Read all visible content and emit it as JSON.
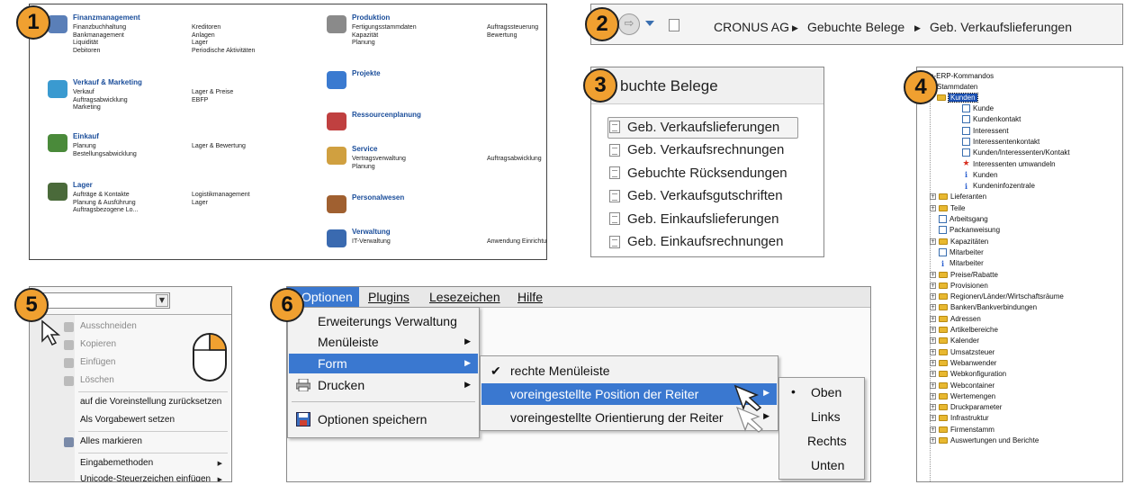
{
  "badges": [
    "1",
    "2",
    "3",
    "4",
    "5",
    "6"
  ],
  "panel1": {
    "groups": [
      {
        "title": "Finanzmanagement",
        "col1": [
          "Finanzbuchhaltung",
          "Bankmanagement",
          "Liquidität",
          "Debitoren"
        ],
        "col2": [
          "Kreditoren",
          "Anlagen",
          "Lager",
          "Periodische Aktivitäten"
        ],
        "icon": "finance-icon",
        "color": "#5a7fb8"
      },
      {
        "title": "Verkauf & Marketing",
        "col1": [
          "Verkauf",
          "Auftragsabwicklung",
          "Marketing"
        ],
        "col2": [
          "Lager & Preise",
          "EBFP"
        ],
        "icon": "globe-icon",
        "color": "#3a9ad0"
      },
      {
        "title": "Einkauf",
        "col1": [
          "Planung",
          "Bestellungsabwicklung"
        ],
        "col2": [
          "Lager & Bewertung"
        ],
        "icon": "purchase-icon",
        "color": "#4a8a3a"
      },
      {
        "title": "Lager",
        "col1": [
          "Aufträge & Kontakte",
          "Planung & Ausführung",
          "Auftragsbezogene Lo..."
        ],
        "col2": [
          "Logistikmanagement",
          "Lager"
        ],
        "icon": "warehouse-icon",
        "color": "#4a6a3a"
      },
      {
        "title": "Produktion",
        "col1": [
          "Fertigungsstammdaten",
          "Kapazität",
          "Planung"
        ],
        "col2": [
          "Auftragssteuerung",
          "Bewertung"
        ],
        "icon": "production-icon",
        "color": "#8a8a8a"
      },
      {
        "title": "Projekte",
        "col1": [],
        "col2": [],
        "icon": "projects-icon",
        "color": "#3a7ad0"
      },
      {
        "title": "Ressourcenplanung",
        "col1": [],
        "col2": [],
        "icon": "resource-planning-icon",
        "color": "#c04040"
      },
      {
        "title": "Service",
        "col1": [
          "Vertragsverwaltung",
          "Planung"
        ],
        "col2": [
          "Auftragsabwicklung"
        ],
        "icon": "service-icon",
        "color": "#d0a040"
      },
      {
        "title": "Personalwesen",
        "col1": [],
        "col2": [],
        "icon": "personnel-icon",
        "color": "#a06030"
      },
      {
        "title": "Verwaltung",
        "col1": [
          "IT-Verwaltung"
        ],
        "col2": [
          "Anwendung Einrichtung"
        ],
        "icon": "administration-icon",
        "color": "#3a6ab0"
      }
    ]
  },
  "panel2": {
    "crumbs": [
      "CRONUS AG",
      "Gebuchte Belege",
      "Geb. Verkaufslieferungen"
    ],
    "separator": "▶"
  },
  "panel3": {
    "header": "buchte Belege",
    "items": [
      "Geb. Verkaufslieferungen",
      "Geb. Verkaufsrechnungen",
      "Gebuchte Rücksendungen",
      "Geb. Verkaufsgutschriften",
      "Geb. Einkaufslieferungen",
      "Geb. Einkaufsrechnungen"
    ]
  },
  "panel4": {
    "root": "ves-ERP-Kommandos",
    "stammdaten": "Stammdaten",
    "kunden": "Kunden",
    "kunden_children": [
      "Kunde",
      "Kundenkontakt",
      "Interessent",
      "Interessentenkontakt",
      "Kunden/Interessenten/Kontakt",
      "Interessenten umwandeln",
      "Kunden",
      "Kundeninfozentrale"
    ],
    "rest": [
      "Lieferanten",
      "Teile",
      "Arbeitsgang",
      "Packanweisung",
      "Kapazitäten",
      "Mitarbeiter",
      "Mitarbeiter",
      "Preise/Rabatte",
      "Provisionen",
      "Regionen/Länder/Wirtschaftsräume",
      "Banken/Bankverbindungen",
      "Adressen",
      "Artikelbereiche",
      "Kalender",
      "Umsatzsteuer",
      "Webanwender",
      "Webkonfiguration",
      "Webcontainer",
      "Wertemengen",
      "Druckparameter",
      "Infrastruktur",
      "Firmenstamm",
      "Auswertungen und Berichte"
    ]
  },
  "panel5": {
    "items": [
      "Ausschneiden",
      "Kopieren",
      "Einfügen",
      "Löschen",
      "auf die Voreinstellung zurücksetzen",
      "Als Vorgabewert setzen",
      "Alles markieren",
      "Eingabemethoden",
      "Unicode-Steuerzeichen einfügen"
    ],
    "dropdown_arrow": "▼"
  },
  "panel6": {
    "menubar": [
      "Optionen",
      "Plugins",
      "Lesezeichen",
      "Hilfe"
    ],
    "menu": [
      "Erweiterungs Verwaltung",
      "Menüleiste",
      "Form",
      "Drucken",
      "Optionen speichern"
    ],
    "submenu": [
      "rechte Menüleiste",
      "voreingestellte Position der Reiter",
      "voreingestellte Orientierung der Reiter"
    ],
    "check": "✔",
    "positions": [
      "Oben",
      "Links",
      "Rechts",
      "Unten"
    ],
    "bullet": "•"
  }
}
